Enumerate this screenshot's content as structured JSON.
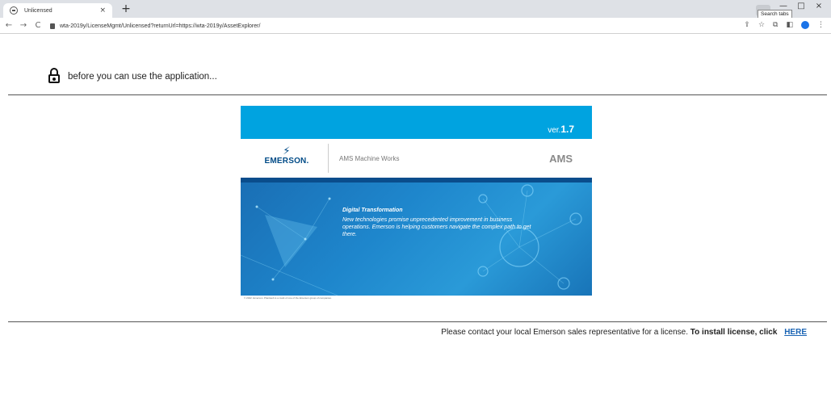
{
  "browser": {
    "tab_title": "Unlicensed",
    "tab_close": "×",
    "new_tab": "+",
    "tooltip": "Search tabs",
    "url": "wta-2019y/LicenseMgmt/Unlicensed?returnUrl=https://wta-2019y/AssetExplorer/",
    "back": "←",
    "forward": "→",
    "reload": "C",
    "minimize": "—",
    "restore": "□",
    "close": "×",
    "share": "⇪",
    "bookmark": "☆",
    "extensions": "⧉",
    "sidepanel": "◧",
    "menu": "⋮"
  },
  "page": {
    "header_text": "before you can use the application...",
    "footer_text": "Please contact your local Emerson sales representative for a license.",
    "footer_bold": "To install license, click",
    "here_link": "HERE"
  },
  "banner": {
    "version_prefix": "ver.",
    "version_number": "1.7",
    "brand": "EMERSON.",
    "product": "AMS Machine Works",
    "ams": "AMS",
    "dt_title": "Digital Transformation",
    "dt_body": "New technologies promise unprecedented improvement in business operations. Emerson is helping customers navigate the complex path to get there.",
    "copyright": "© 2022. Emerson. Plantweb is a mark of one of the Emerson group of companies."
  },
  "colors": {
    "banner_top": "#00a3e0",
    "brand_blue": "#004b87",
    "link": "#1a64b4"
  }
}
